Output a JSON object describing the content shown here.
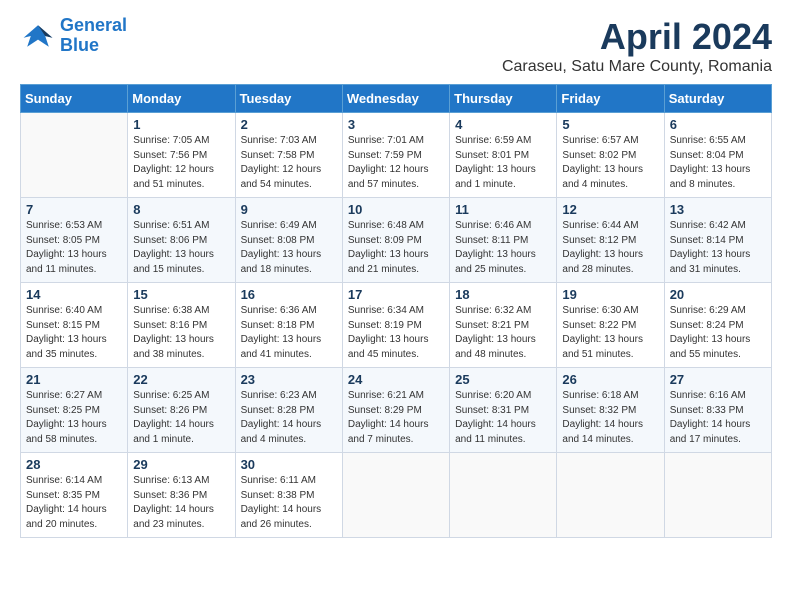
{
  "header": {
    "logo_line1": "General",
    "logo_line2": "Blue",
    "title": "April 2024",
    "subtitle": "Caraseu, Satu Mare County, Romania"
  },
  "weekdays": [
    "Sunday",
    "Monday",
    "Tuesday",
    "Wednesday",
    "Thursday",
    "Friday",
    "Saturday"
  ],
  "weeks": [
    [
      {
        "day": "",
        "sunrise": "",
        "sunset": "",
        "daylight": ""
      },
      {
        "day": "1",
        "sunrise": "Sunrise: 7:05 AM",
        "sunset": "Sunset: 7:56 PM",
        "daylight": "Daylight: 12 hours and 51 minutes."
      },
      {
        "day": "2",
        "sunrise": "Sunrise: 7:03 AM",
        "sunset": "Sunset: 7:58 PM",
        "daylight": "Daylight: 12 hours and 54 minutes."
      },
      {
        "day": "3",
        "sunrise": "Sunrise: 7:01 AM",
        "sunset": "Sunset: 7:59 PM",
        "daylight": "Daylight: 12 hours and 57 minutes."
      },
      {
        "day": "4",
        "sunrise": "Sunrise: 6:59 AM",
        "sunset": "Sunset: 8:01 PM",
        "daylight": "Daylight: 13 hours and 1 minute."
      },
      {
        "day": "5",
        "sunrise": "Sunrise: 6:57 AM",
        "sunset": "Sunset: 8:02 PM",
        "daylight": "Daylight: 13 hours and 4 minutes."
      },
      {
        "day": "6",
        "sunrise": "Sunrise: 6:55 AM",
        "sunset": "Sunset: 8:04 PM",
        "daylight": "Daylight: 13 hours and 8 minutes."
      }
    ],
    [
      {
        "day": "7",
        "sunrise": "Sunrise: 6:53 AM",
        "sunset": "Sunset: 8:05 PM",
        "daylight": "Daylight: 13 hours and 11 minutes."
      },
      {
        "day": "8",
        "sunrise": "Sunrise: 6:51 AM",
        "sunset": "Sunset: 8:06 PM",
        "daylight": "Daylight: 13 hours and 15 minutes."
      },
      {
        "day": "9",
        "sunrise": "Sunrise: 6:49 AM",
        "sunset": "Sunset: 8:08 PM",
        "daylight": "Daylight: 13 hours and 18 minutes."
      },
      {
        "day": "10",
        "sunrise": "Sunrise: 6:48 AM",
        "sunset": "Sunset: 8:09 PM",
        "daylight": "Daylight: 13 hours and 21 minutes."
      },
      {
        "day": "11",
        "sunrise": "Sunrise: 6:46 AM",
        "sunset": "Sunset: 8:11 PM",
        "daylight": "Daylight: 13 hours and 25 minutes."
      },
      {
        "day": "12",
        "sunrise": "Sunrise: 6:44 AM",
        "sunset": "Sunset: 8:12 PM",
        "daylight": "Daylight: 13 hours and 28 minutes."
      },
      {
        "day": "13",
        "sunrise": "Sunrise: 6:42 AM",
        "sunset": "Sunset: 8:14 PM",
        "daylight": "Daylight: 13 hours and 31 minutes."
      }
    ],
    [
      {
        "day": "14",
        "sunrise": "Sunrise: 6:40 AM",
        "sunset": "Sunset: 8:15 PM",
        "daylight": "Daylight: 13 hours and 35 minutes."
      },
      {
        "day": "15",
        "sunrise": "Sunrise: 6:38 AM",
        "sunset": "Sunset: 8:16 PM",
        "daylight": "Daylight: 13 hours and 38 minutes."
      },
      {
        "day": "16",
        "sunrise": "Sunrise: 6:36 AM",
        "sunset": "Sunset: 8:18 PM",
        "daylight": "Daylight: 13 hours and 41 minutes."
      },
      {
        "day": "17",
        "sunrise": "Sunrise: 6:34 AM",
        "sunset": "Sunset: 8:19 PM",
        "daylight": "Daylight: 13 hours and 45 minutes."
      },
      {
        "day": "18",
        "sunrise": "Sunrise: 6:32 AM",
        "sunset": "Sunset: 8:21 PM",
        "daylight": "Daylight: 13 hours and 48 minutes."
      },
      {
        "day": "19",
        "sunrise": "Sunrise: 6:30 AM",
        "sunset": "Sunset: 8:22 PM",
        "daylight": "Daylight: 13 hours and 51 minutes."
      },
      {
        "day": "20",
        "sunrise": "Sunrise: 6:29 AM",
        "sunset": "Sunset: 8:24 PM",
        "daylight": "Daylight: 13 hours and 55 minutes."
      }
    ],
    [
      {
        "day": "21",
        "sunrise": "Sunrise: 6:27 AM",
        "sunset": "Sunset: 8:25 PM",
        "daylight": "Daylight: 13 hours and 58 minutes."
      },
      {
        "day": "22",
        "sunrise": "Sunrise: 6:25 AM",
        "sunset": "Sunset: 8:26 PM",
        "daylight": "Daylight: 14 hours and 1 minute."
      },
      {
        "day": "23",
        "sunrise": "Sunrise: 6:23 AM",
        "sunset": "Sunset: 8:28 PM",
        "daylight": "Daylight: 14 hours and 4 minutes."
      },
      {
        "day": "24",
        "sunrise": "Sunrise: 6:21 AM",
        "sunset": "Sunset: 8:29 PM",
        "daylight": "Daylight: 14 hours and 7 minutes."
      },
      {
        "day": "25",
        "sunrise": "Sunrise: 6:20 AM",
        "sunset": "Sunset: 8:31 PM",
        "daylight": "Daylight: 14 hours and 11 minutes."
      },
      {
        "day": "26",
        "sunrise": "Sunrise: 6:18 AM",
        "sunset": "Sunset: 8:32 PM",
        "daylight": "Daylight: 14 hours and 14 minutes."
      },
      {
        "day": "27",
        "sunrise": "Sunrise: 6:16 AM",
        "sunset": "Sunset: 8:33 PM",
        "daylight": "Daylight: 14 hours and 17 minutes."
      }
    ],
    [
      {
        "day": "28",
        "sunrise": "Sunrise: 6:14 AM",
        "sunset": "Sunset: 8:35 PM",
        "daylight": "Daylight: 14 hours and 20 minutes."
      },
      {
        "day": "29",
        "sunrise": "Sunrise: 6:13 AM",
        "sunset": "Sunset: 8:36 PM",
        "daylight": "Daylight: 14 hours and 23 minutes."
      },
      {
        "day": "30",
        "sunrise": "Sunrise: 6:11 AM",
        "sunset": "Sunset: 8:38 PM",
        "daylight": "Daylight: 14 hours and 26 minutes."
      },
      {
        "day": "",
        "sunrise": "",
        "sunset": "",
        "daylight": ""
      },
      {
        "day": "",
        "sunrise": "",
        "sunset": "",
        "daylight": ""
      },
      {
        "day": "",
        "sunrise": "",
        "sunset": "",
        "daylight": ""
      },
      {
        "day": "",
        "sunrise": "",
        "sunset": "",
        "daylight": ""
      }
    ]
  ]
}
